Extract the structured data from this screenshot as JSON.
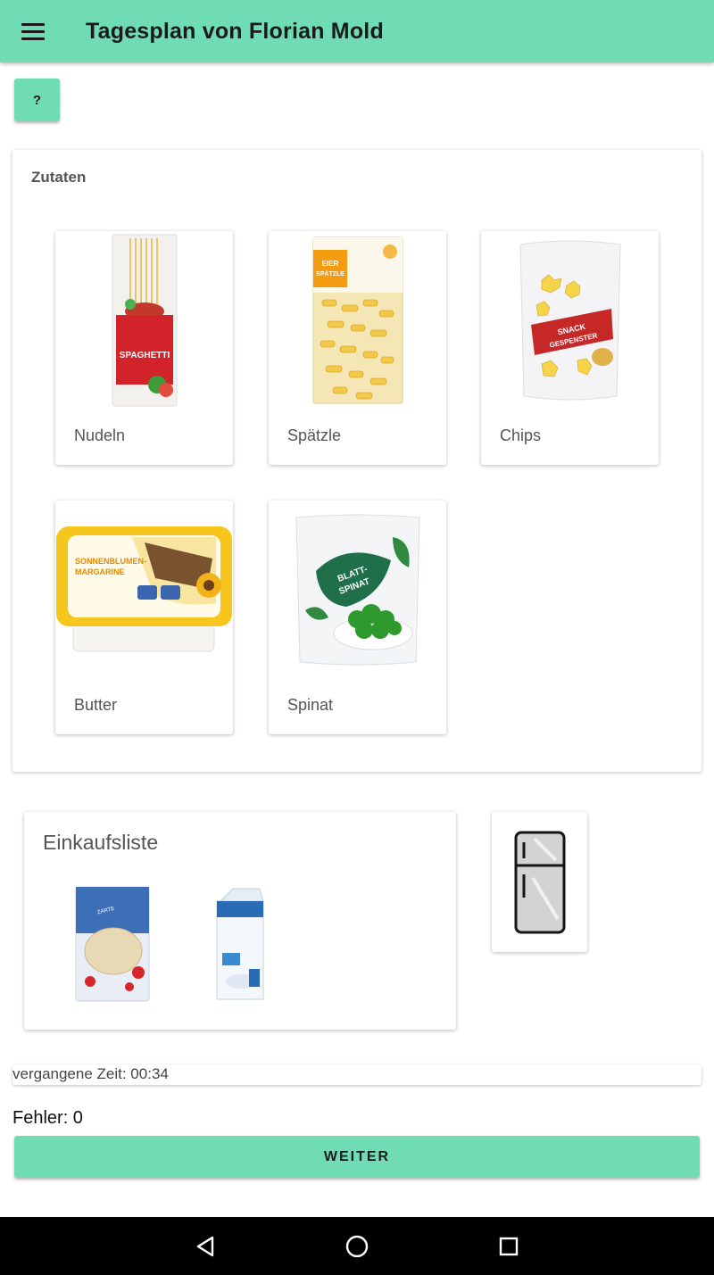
{
  "app": {
    "title": "Tagesplan von Florian Mold",
    "menu_icon": "menu-icon",
    "accent_color": "#6fdcb3"
  },
  "help_button": {
    "label": "?"
  },
  "ingredients": {
    "title": "Zutaten",
    "items": [
      {
        "label": "Nudeln",
        "icon": "spaghetti-package"
      },
      {
        "label": "Spätzle",
        "icon": "spaetzle-package"
      },
      {
        "label": "Chips",
        "icon": "chips-bag"
      },
      {
        "label": "Butter",
        "icon": "margarine-tub"
      },
      {
        "label": "Spinat",
        "icon": "spinach-bag"
      }
    ]
  },
  "shopping_list": {
    "title": "Einkaufsliste",
    "items": [
      {
        "icon": "oat-flakes-package"
      },
      {
        "icon": "milk-carton"
      }
    ]
  },
  "fridge": {
    "icon": "fridge-icon"
  },
  "timer": {
    "text": "vergangene Zeit: 00:34"
  },
  "errors": {
    "text": "Fehler: 0"
  },
  "next_button": {
    "label": "WEITER"
  },
  "system_nav": {
    "back_icon": "back-triangle-icon",
    "home_icon": "home-circle-icon",
    "recents_icon": "recents-square-icon"
  }
}
